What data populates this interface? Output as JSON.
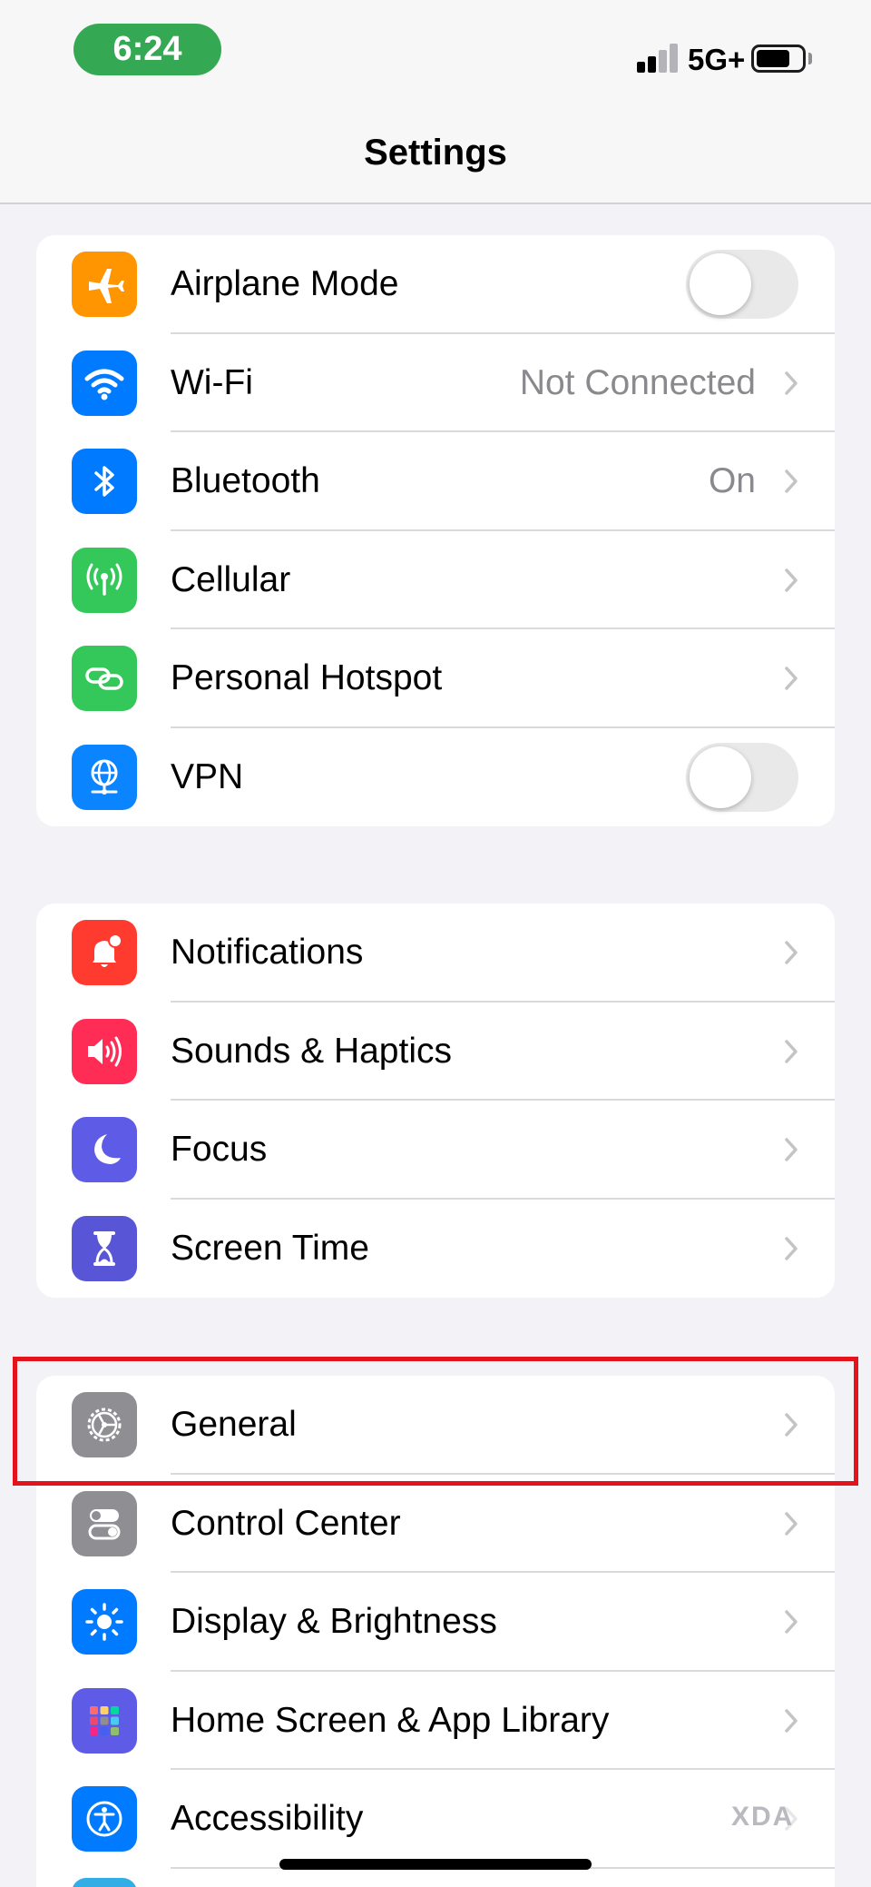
{
  "status_bar": {
    "time": "6:24",
    "network": "5G+",
    "time_pill_color": "#34a852"
  },
  "nav": {
    "title": "Settings"
  },
  "groups": [
    {
      "rows": [
        {
          "id": "airplane",
          "label": "Airplane Mode",
          "icon": "airplane-icon",
          "icon_color": "#ff9500",
          "control": "toggle",
          "toggle_on": false
        },
        {
          "id": "wifi",
          "label": "Wi-Fi",
          "value": "Not Connected",
          "icon": "wifi-icon",
          "icon_color": "#007aff",
          "control": "chevron"
        },
        {
          "id": "bluetooth",
          "label": "Bluetooth",
          "value": "On",
          "icon": "bluetooth-icon",
          "icon_color": "#007aff",
          "control": "chevron"
        },
        {
          "id": "cellular",
          "label": "Cellular",
          "icon": "antenna-icon",
          "icon_color": "#34c759",
          "control": "chevron"
        },
        {
          "id": "hotspot",
          "label": "Personal Hotspot",
          "icon": "link-icon",
          "icon_color": "#34c759",
          "control": "chevron"
        },
        {
          "id": "vpn",
          "label": "VPN",
          "icon": "globe-network-icon",
          "icon_color": "#0a84ff",
          "control": "toggle",
          "toggle_on": false
        }
      ]
    },
    {
      "rows": [
        {
          "id": "notifications",
          "label": "Notifications",
          "icon": "bell-icon",
          "icon_color": "#ff3b30",
          "control": "chevron"
        },
        {
          "id": "sounds",
          "label": "Sounds & Haptics",
          "icon": "speaker-icon",
          "icon_color": "#ff2d55",
          "control": "chevron"
        },
        {
          "id": "focus",
          "label": "Focus",
          "icon": "moon-icon",
          "icon_color": "#5e5ce6",
          "control": "chevron"
        },
        {
          "id": "screentime",
          "label": "Screen Time",
          "icon": "hourglass-icon",
          "icon_color": "#5856d6",
          "control": "chevron"
        }
      ]
    },
    {
      "rows": [
        {
          "id": "general",
          "label": "General",
          "icon": "gear-icon",
          "icon_color": "#8e8e93",
          "control": "chevron",
          "highlighted": true
        },
        {
          "id": "controlcenter",
          "label": "Control Center",
          "icon": "switches-icon",
          "icon_color": "#8e8e93",
          "control": "chevron"
        },
        {
          "id": "display",
          "label": "Display & Brightness",
          "icon": "sun-icon",
          "icon_color": "#007aff",
          "control": "chevron"
        },
        {
          "id": "homescreen",
          "label": "Home Screen & App Library",
          "icon": "app-grid-icon",
          "icon_color": "#5e5ce6",
          "control": "chevron"
        },
        {
          "id": "accessibility",
          "label": "Accessibility",
          "icon": "accessibility-icon",
          "icon_color": "#007aff",
          "control": "chevron"
        }
      ]
    }
  ],
  "highlight_color": "#e3141c",
  "watermark": "XDA"
}
